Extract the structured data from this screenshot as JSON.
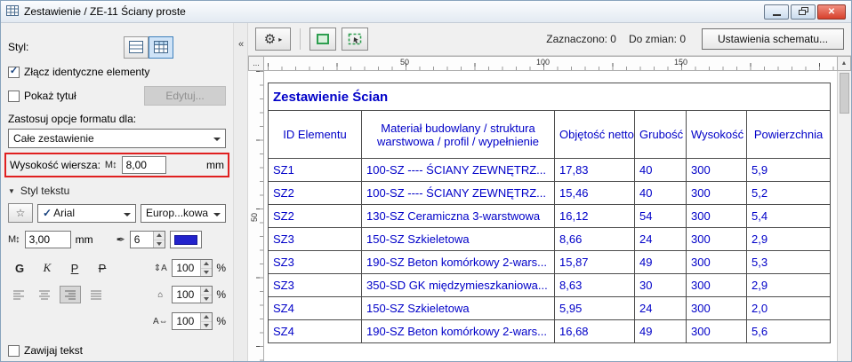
{
  "window": {
    "title": "Zestawienie / ZE-11 Ściany proste"
  },
  "icons": {
    "checkmark": "✓",
    "close": "✕",
    "gear": "⚙",
    "flyout_arrow": "▸",
    "collapse_arrows": "«",
    "scroll_up_arrow": "▲",
    "section_triangle": "▼",
    "m_letter": "M",
    "updown_arrow": "↕",
    "pen_nib": "✒",
    "star": "☆",
    "line_spacing": "⇕A",
    "width_factor": "⌂",
    "char_spacing": "A⇔"
  },
  "left_panel": {
    "style_label": "Styl:",
    "merge_identical_label": "Złącz identyczne elementy",
    "show_title_label": "Pokaż tytuł",
    "edit_button": "Edytuj...",
    "apply_format_label": "Zastosuj opcje formatu dla:",
    "format_scope_value": "Całe zestawienie",
    "row_height_label": "Wysokość wiersza:",
    "row_height_value": "8,00",
    "row_height_unit": "mm",
    "text_style_header": "Styl tekstu",
    "font_name": "Arial",
    "encoding_value": "Europ...kowa",
    "font_size_value": "3,00",
    "font_size_unit": "mm",
    "pen_number": "6",
    "bold_label": "G",
    "italic_label": "K",
    "underline_label": "P",
    "strike_label": "P",
    "line_spacing_value": "100",
    "width_factor_value": "100",
    "char_spacing_value": "100",
    "percent": "%",
    "wrap_text_label": "Zawijaj tekst"
  },
  "toolbar": {
    "selected_count_label": "Zaznaczono: 0",
    "to_change_label": "Do zmian: 0",
    "scheme_settings_button": "Ustawienia schematu..."
  },
  "ruler": {
    "corner_label": "...",
    "h_labels": [
      "50",
      "100",
      "150"
    ],
    "v_label": "50"
  },
  "table": {
    "title": "Zestawienie Ścian",
    "headers": [
      "ID Elementu",
      "Materiał budowlany / struktura warstwowa / profil / wypełnienie",
      "Objętość netto",
      "Grubość",
      "Wysokość",
      "Powierzchnia"
    ],
    "rows": [
      {
        "id": "SZ1",
        "material": "100-SZ ---- ŚCIANY ZEWNĘTRZ...",
        "volume": "17,83",
        "thickness": "40",
        "height": "300",
        "area": "5,9"
      },
      {
        "id": "SZ2",
        "material": "100-SZ ---- ŚCIANY ZEWNĘTRZ...",
        "volume": "15,46",
        "thickness": "40",
        "height": "300",
        "area": "5,2"
      },
      {
        "id": "SZ2",
        "material": "130-SZ Ceramiczna  3-warstwowa",
        "volume": "16,12",
        "thickness": "54",
        "height": "300",
        "area": "5,4"
      },
      {
        "id": "SZ3",
        "material": "150-SZ Szkieletowa",
        "volume": "8,66",
        "thickness": "24",
        "height": "300",
        "area": "2,9"
      },
      {
        "id": "SZ3",
        "material": "190-SZ Beton komórkowy 2-wars...",
        "volume": "15,87",
        "thickness": "49",
        "height": "300",
        "area": "5,3"
      },
      {
        "id": "SZ3",
        "material": "350-SD GK międzymieszkaniowa...",
        "volume": "8,63",
        "thickness": "30",
        "height": "300",
        "area": "2,9"
      },
      {
        "id": "SZ4",
        "material": "150-SZ Szkieletowa",
        "volume": "5,95",
        "thickness": "24",
        "height": "300",
        "area": "2,0"
      },
      {
        "id": "SZ4",
        "material": "190-SZ Beton komórkowy 2-wars...",
        "volume": "16,68",
        "thickness": "49",
        "height": "300",
        "area": "5,6"
      }
    ]
  },
  "colors": {
    "table_text": "#0000c8",
    "highlight_border": "#e02020",
    "selection_green": "#2d9e4f"
  }
}
